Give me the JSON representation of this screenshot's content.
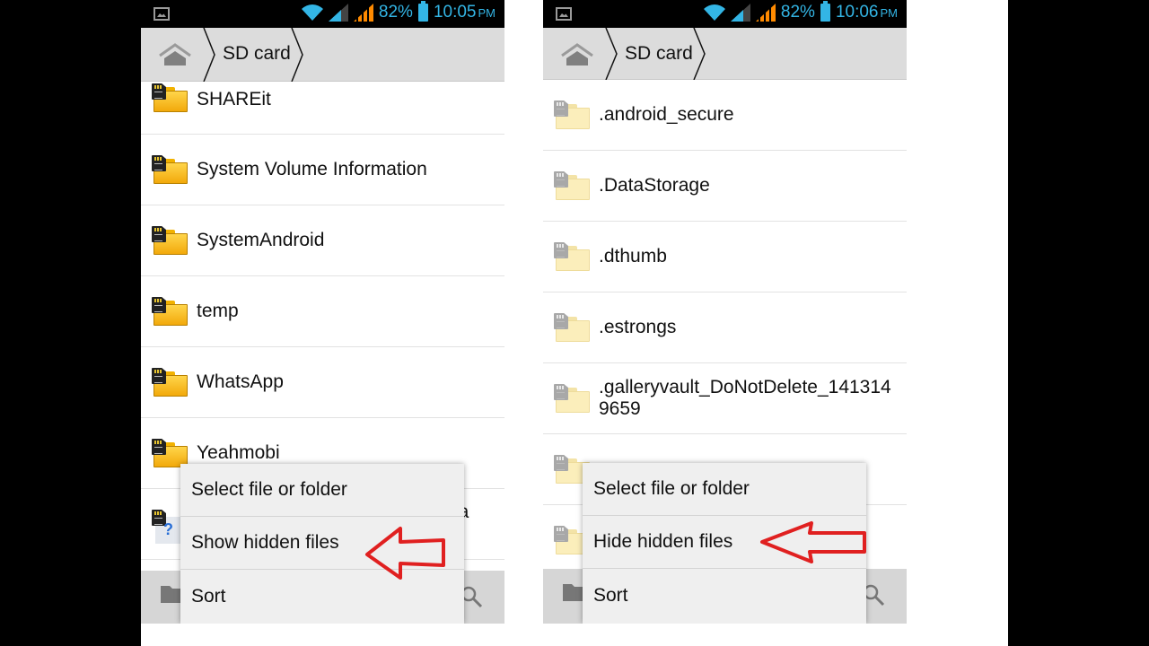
{
  "panels": [
    {
      "id": "before",
      "status_bar": {
        "battery_percent": "82%",
        "time": "10:05",
        "ampm": "PM"
      },
      "breadcrumb": {
        "home_label": "Home",
        "current": "SD card"
      },
      "files": [
        {
          "name": "SHAREit",
          "icon": "folder-sdcard-icon"
        },
        {
          "name": "System Volume Information",
          "icon": "folder-sdcard-icon"
        },
        {
          "name": "SystemAndroid",
          "icon": "folder-sdcard-icon"
        },
        {
          "name": "temp",
          "icon": "folder-sdcard-icon"
        },
        {
          "name": "WhatsApp",
          "icon": "folder-sdcard-icon"
        },
        {
          "name": "Yeahmobi",
          "icon": "folder-sdcard-icon"
        },
        {
          "name": "ba",
          "icon": "unknown-file-icon"
        }
      ],
      "menu": [
        "Select file or folder",
        "Show hidden files",
        "Sort"
      ],
      "highlighted_menu_item": "Show hidden files"
    },
    {
      "id": "after",
      "status_bar": {
        "battery_percent": "82%",
        "time": "10:06",
        "ampm": "PM"
      },
      "breadcrumb": {
        "home_label": "Home",
        "current": "SD card"
      },
      "files": [
        {
          "name": ".android_secure",
          "icon": "hidden-folder-icon"
        },
        {
          "name": ".DataStorage",
          "icon": "hidden-folder-icon"
        },
        {
          "name": ".dthumb",
          "icon": "hidden-folder-icon"
        },
        {
          "name": ".estrongs",
          "icon": "hidden-folder-icon"
        },
        {
          "name": ".galleryvault_DoNotDelete_1413149659",
          "icon": "hidden-folder-icon"
        },
        {
          "name": "",
          "icon": "hidden-folder-icon"
        },
        {
          "name": "",
          "icon": "hidden-folder-icon"
        }
      ],
      "menu": [
        "Select file or folder",
        "Hide hidden files",
        "Sort"
      ],
      "highlighted_menu_item": "Hide hidden files"
    }
  ],
  "colors": {
    "accent": "#33b5e5",
    "signal_orange": "#ff8a00",
    "arrow_red": "#e02020",
    "folder_yellow": "#f7c21c"
  }
}
